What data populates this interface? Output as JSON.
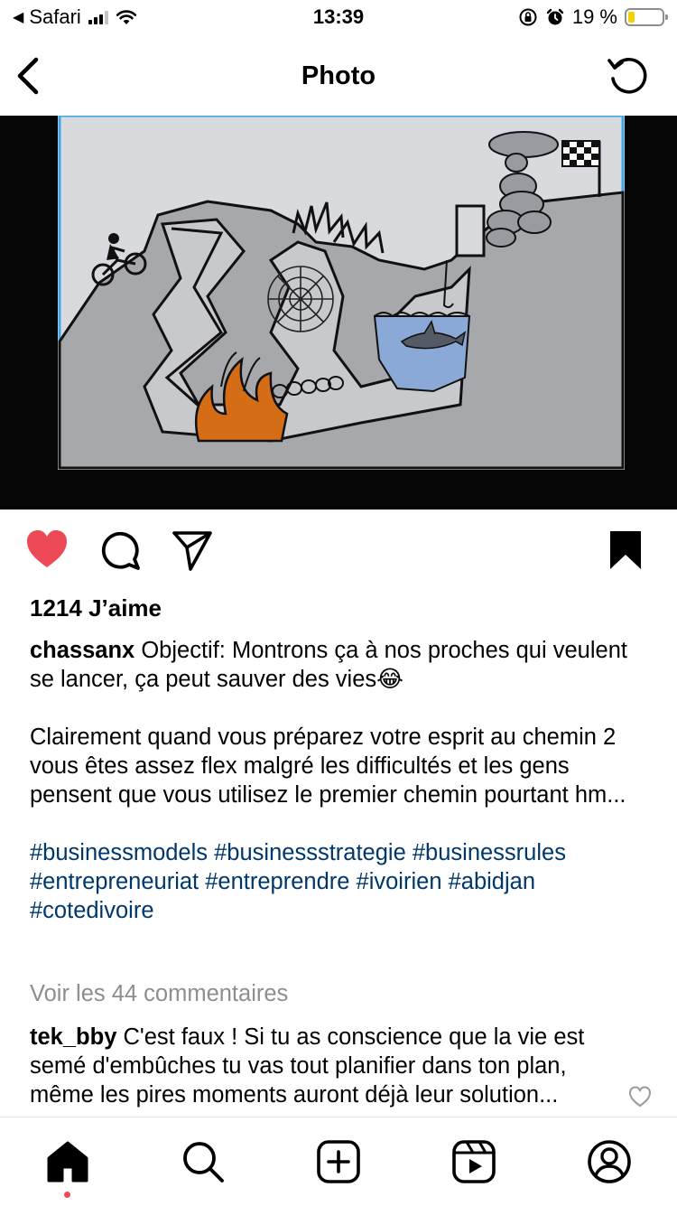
{
  "status_bar": {
    "back_app": "Safari",
    "time": "13:39",
    "battery": "19 %",
    "battery_level": 0.19
  },
  "header": {
    "title": "Photo",
    "back_icon": "chevron-left-icon",
    "refresh_icon": "refresh-icon"
  },
  "post": {
    "liked": true,
    "saved": true,
    "likes_text": "1214 J’aime",
    "author": "chassanx",
    "caption_first": " Objectif: Montrons ça à nos proches qui veulent se lancer, ça peut sauver des vies😂",
    "caption_second": "Clairement quand vous préparez votre esprit au chemin 2 vous êtes assez flex malgré les difficultés et les gens pensent que vous utilisez le premier chemin pourtant hm...",
    "hashtags": [
      "#businessmodels",
      "#businessstrategie",
      "#businessrules",
      "#entrepreneuriat",
      "#entreprendre",
      "#ivoirien",
      "#abidjan",
      "#cotedivoire"
    ],
    "view_comments": "Voir les 44 commentaires",
    "comment": {
      "user": "tek_bby",
      "text": " C'est faux ! Si tu as conscience que la vie est semé d'embûches tu vas tout planifier dans ton plan, même les pires moments auront déjà leur solution..."
    }
  },
  "colors": {
    "like_red": "#ed4956",
    "hashtag_blue": "#00376b",
    "muted_gray": "#8e8e8e"
  },
  "tabbar": {
    "items": [
      "home-icon",
      "search-icon",
      "add-post-icon",
      "reels-icon",
      "profile-icon"
    ],
    "active": "home-icon"
  }
}
